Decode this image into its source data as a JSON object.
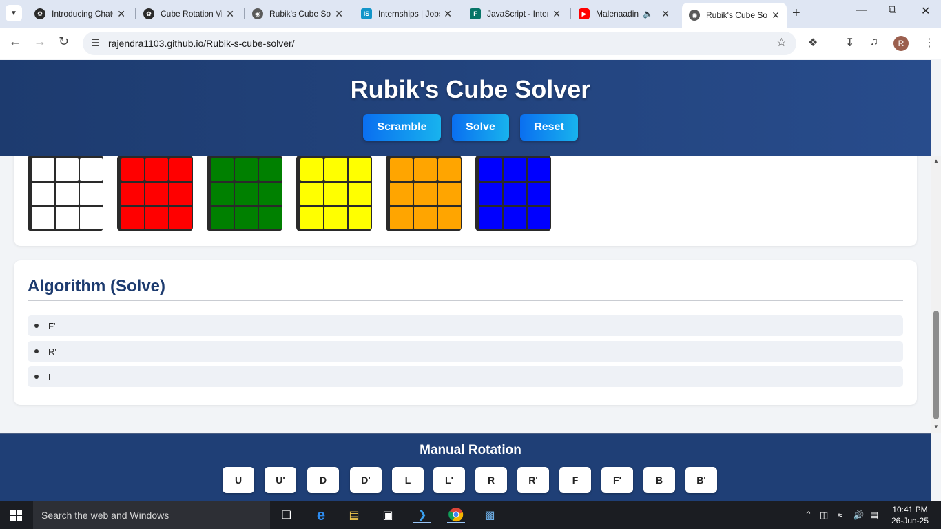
{
  "tabs": [
    {
      "title": "Introducing ChatGPT",
      "icon": "openai-icon",
      "color": "#2b2b2b"
    },
    {
      "title": "Cube Rotation Visualizer",
      "icon": "openai-icon",
      "color": "#2b2b2b"
    },
    {
      "title": "Rubik's Cube Solver",
      "icon": "globe-icon",
      "color": "#5a5a5a"
    },
    {
      "title": "Internships | Jobs",
      "icon": "internshala-icon",
      "color": "#1295c9"
    },
    {
      "title": "JavaScript - Interview",
      "icon": "forms-icon",
      "color": "#077568"
    },
    {
      "title": "Malenaadina",
      "icon": "youtube-icon",
      "color": "#ff0000"
    },
    {
      "title": "Rubik's Cube Solver",
      "icon": "globe-icon",
      "color": "#5a5a5a"
    }
  ],
  "browser": {
    "url": "rajendra1103.github.io/Rubik-s-cube-solver/",
    "profile_initial": "R"
  },
  "header": {
    "title": "Rubik's Cube Solver",
    "buttons": [
      "Scramble",
      "Solve",
      "Reset"
    ]
  },
  "faces": [
    {
      "name": "white",
      "color": "#ffffff"
    },
    {
      "name": "red",
      "color": "#ff0000"
    },
    {
      "name": "green",
      "color": "#008000"
    },
    {
      "name": "yellow",
      "color": "#ffff00"
    },
    {
      "name": "orange",
      "color": "#ffa500"
    },
    {
      "name": "blue",
      "color": "#0000ff"
    }
  ],
  "algorithm": {
    "title": "Algorithm (Solve)",
    "moves": [
      "F'",
      "R'",
      "L"
    ]
  },
  "manual": {
    "title": "Manual Rotation",
    "moves": [
      "U",
      "U'",
      "D",
      "D'",
      "L",
      "L'",
      "R",
      "R'",
      "F",
      "F'",
      "B",
      "B'"
    ]
  },
  "taskbar": {
    "search_placeholder": "Search the web and Windows",
    "time": "10:41 PM",
    "date": "26-Jun-25"
  }
}
